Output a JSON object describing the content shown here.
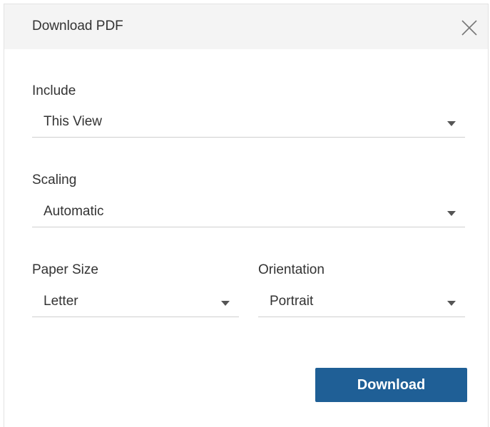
{
  "dialog": {
    "title": "Download PDF",
    "close_icon": "close-icon"
  },
  "include": {
    "label": "Include",
    "value": "This View",
    "icon": "chevron-down-icon"
  },
  "scaling": {
    "label": "Scaling",
    "value": "Automatic",
    "icon": "chevron-down-icon"
  },
  "paper_size": {
    "label": "Paper Size",
    "value": "Letter",
    "icon": "chevron-down-icon"
  },
  "orientation": {
    "label": "Orientation",
    "value": "Portrait",
    "icon": "chevron-down-icon"
  },
  "actions": {
    "download_label": "Download"
  },
  "colors": {
    "primary_button": "#1f5f96",
    "header_background": "#f4f4f4",
    "text": "#333333"
  }
}
